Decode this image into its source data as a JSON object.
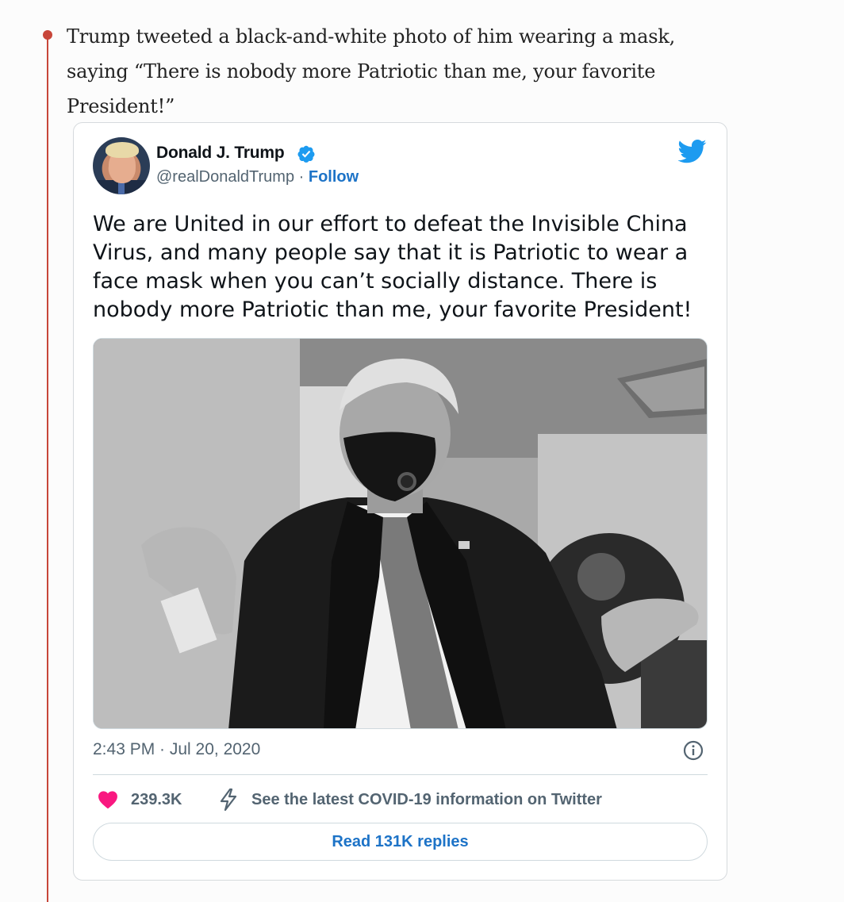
{
  "caption": {
    "text": "Trump tweeted a black-and-white photo of him wearing a mask, saying “There is nobody more Patriotic than me, your favorite President!”"
  },
  "tweet": {
    "author_name": "Donald J. Trump",
    "handle": "@realDonaldTrump",
    "separator": " · ",
    "follow_label": "Follow",
    "text": "We are United in our effort to defeat the Invisible China Virus, and many people say that it is Patriotic to wear a face mask when you can’t socially distance. There is nobody more Patriotic than me, your favorite President!",
    "timestamp": "2:43 PM · Jul 20, 2020",
    "like_count": "239.3K",
    "covid_link": "See the latest COVID-19 information on Twitter",
    "replies_button": "Read 131K replies"
  },
  "icons": {
    "verified": "verified-badge-icon",
    "twitter": "twitter-bird-icon",
    "info": "info-icon",
    "heart": "heart-icon",
    "bolt": "lightning-bolt-icon"
  },
  "colors": {
    "timeline": "#c8463a",
    "twitter_blue": "#1d9bf0",
    "link_blue": "#1d73c7",
    "heart_pink": "#f91880",
    "muted_text": "#536471"
  }
}
